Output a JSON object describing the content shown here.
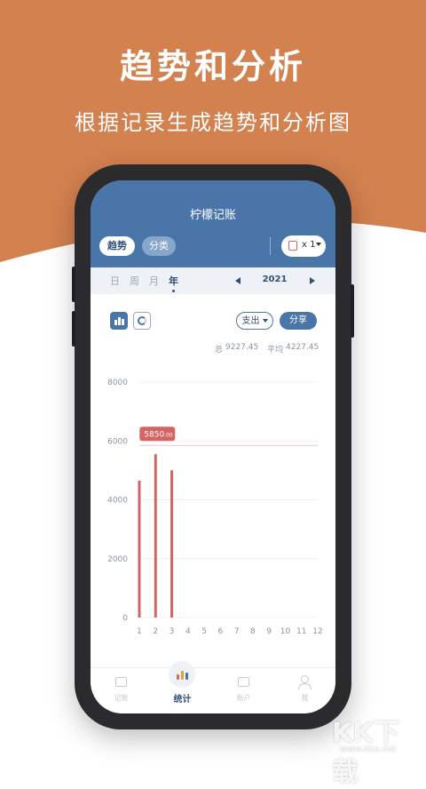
{
  "promo": {
    "title": "趋势和分析",
    "subtitle": "根据记录生成趋势和分析图",
    "background_color": "#d3814f"
  },
  "app": {
    "title": "柠檬记账",
    "header_color": "#4a75a8",
    "segments": {
      "trend": "趋势",
      "category": "分类"
    },
    "book_multiplier": "x 1"
  },
  "period": {
    "tabs": [
      "日",
      "周",
      "月",
      "年"
    ],
    "selected": "年",
    "year": "2021"
  },
  "toolbar": {
    "type_select": "支出",
    "share": "分享"
  },
  "summary": {
    "total_label": "总",
    "total_value": "9227.45",
    "avg_label": "平均",
    "avg_value": "4227.45"
  },
  "chart_data": {
    "type": "bar",
    "categories": [
      "1",
      "2",
      "3",
      "4",
      "5",
      "6",
      "7",
      "8",
      "9",
      "10",
      "11",
      "12"
    ],
    "values": [
      4650,
      5550,
      5000,
      0,
      0,
      0,
      0,
      0,
      0,
      0,
      0,
      0
    ],
    "ylim": [
      0,
      8000
    ],
    "yticks": [
      "8000",
      "6000",
      "4000",
      "2000",
      "0"
    ],
    "grid": true,
    "bar_color": "#d56464",
    "highlight_line": 5850,
    "tooltip": {
      "integer": "5850",
      "decimal": ".00"
    }
  },
  "tabbar": {
    "tabs": [
      {
        "label": "记账",
        "icon": "wallet-icon"
      },
      {
        "label": "统计",
        "icon": "stats-icon"
      },
      {
        "label": "账户",
        "icon": "account-icon"
      },
      {
        "label": "我",
        "icon": "user-icon"
      }
    ]
  },
  "watermark": {
    "text": "KK下载",
    "url": "www.kkx.net"
  }
}
